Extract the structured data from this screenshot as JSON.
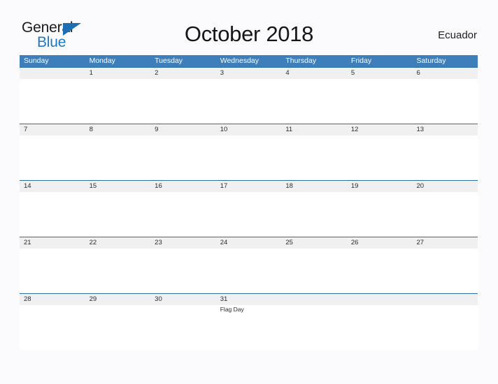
{
  "brand": {
    "name_part1": "General",
    "name_part2": "Blue",
    "flag_icon": "triangle-flag-icon",
    "primary_color": "#1c6fb5",
    "text_color": "#1b1b1b"
  },
  "header": {
    "title": "October 2018",
    "region": "Ecuador"
  },
  "calendar": {
    "header_bg_color": "#3d7ebb",
    "date_band_color": "#f0f0f0",
    "row_border_color": "#2e6da4",
    "weekdays": [
      "Sunday",
      "Monday",
      "Tuesday",
      "Wednesday",
      "Thursday",
      "Friday",
      "Saturday"
    ],
    "weeks": [
      [
        {
          "date": "",
          "event": ""
        },
        {
          "date": "1",
          "event": ""
        },
        {
          "date": "2",
          "event": ""
        },
        {
          "date": "3",
          "event": ""
        },
        {
          "date": "4",
          "event": ""
        },
        {
          "date": "5",
          "event": ""
        },
        {
          "date": "6",
          "event": ""
        }
      ],
      [
        {
          "date": "7",
          "event": ""
        },
        {
          "date": "8",
          "event": ""
        },
        {
          "date": "9",
          "event": ""
        },
        {
          "date": "10",
          "event": ""
        },
        {
          "date": "11",
          "event": ""
        },
        {
          "date": "12",
          "event": ""
        },
        {
          "date": "13",
          "event": ""
        }
      ],
      [
        {
          "date": "14",
          "event": ""
        },
        {
          "date": "15",
          "event": ""
        },
        {
          "date": "16",
          "event": ""
        },
        {
          "date": "17",
          "event": ""
        },
        {
          "date": "18",
          "event": ""
        },
        {
          "date": "19",
          "event": ""
        },
        {
          "date": "20",
          "event": ""
        }
      ],
      [
        {
          "date": "21",
          "event": ""
        },
        {
          "date": "22",
          "event": ""
        },
        {
          "date": "23",
          "event": ""
        },
        {
          "date": "24",
          "event": ""
        },
        {
          "date": "25",
          "event": ""
        },
        {
          "date": "26",
          "event": ""
        },
        {
          "date": "27",
          "event": ""
        }
      ],
      [
        {
          "date": "28",
          "event": ""
        },
        {
          "date": "29",
          "event": ""
        },
        {
          "date": "30",
          "event": ""
        },
        {
          "date": "31",
          "event": "Flag Day"
        },
        {
          "date": "",
          "event": ""
        },
        {
          "date": "",
          "event": ""
        },
        {
          "date": "",
          "event": ""
        }
      ]
    ]
  }
}
